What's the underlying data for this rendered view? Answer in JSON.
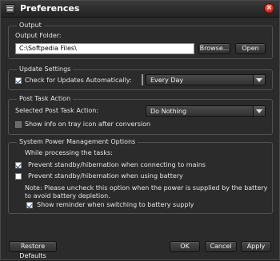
{
  "window": {
    "title": "Preferences"
  },
  "output": {
    "legend": "Output",
    "folder_label": "Output Folder:",
    "folder_value": "C:\\Softpedia Files\\",
    "browse_label": "Browse...",
    "open_label": "Open"
  },
  "update": {
    "legend": "Update Settings",
    "check_label": "Check for Updates Automatically:",
    "check_checked": true,
    "frequency_value": "Every Day"
  },
  "post_task": {
    "legend": "Post Task Action",
    "action_label": "Selected Post Task Action:",
    "action_value": "Do Nothing",
    "tray_label": "Show info on tray icon after conversion",
    "tray_checked": false
  },
  "power": {
    "legend": "System Power Management Options",
    "while_label": "While processing the tasks:",
    "prevent_mains_label": "Prevent standby/hibernation when connecting to mains",
    "prevent_mains_checked": true,
    "prevent_battery_label": "Prevent standby/hibernation when using battery",
    "prevent_battery_checked": false,
    "note": "Note: Please uncheck this option when the power is supplied by the battery to avoid battery depletion.",
    "reminder_label": "Show reminder when switching to battery supply",
    "reminder_checked": true
  },
  "footer": {
    "restore_label": "Restore Defaults",
    "ok_label": "OK",
    "cancel_label": "Cancel",
    "apply_label": "Apply"
  },
  "colors": {
    "background": "#2b2b2b",
    "close_button": "#d9281c",
    "checkmark": "#1d4fa0"
  }
}
